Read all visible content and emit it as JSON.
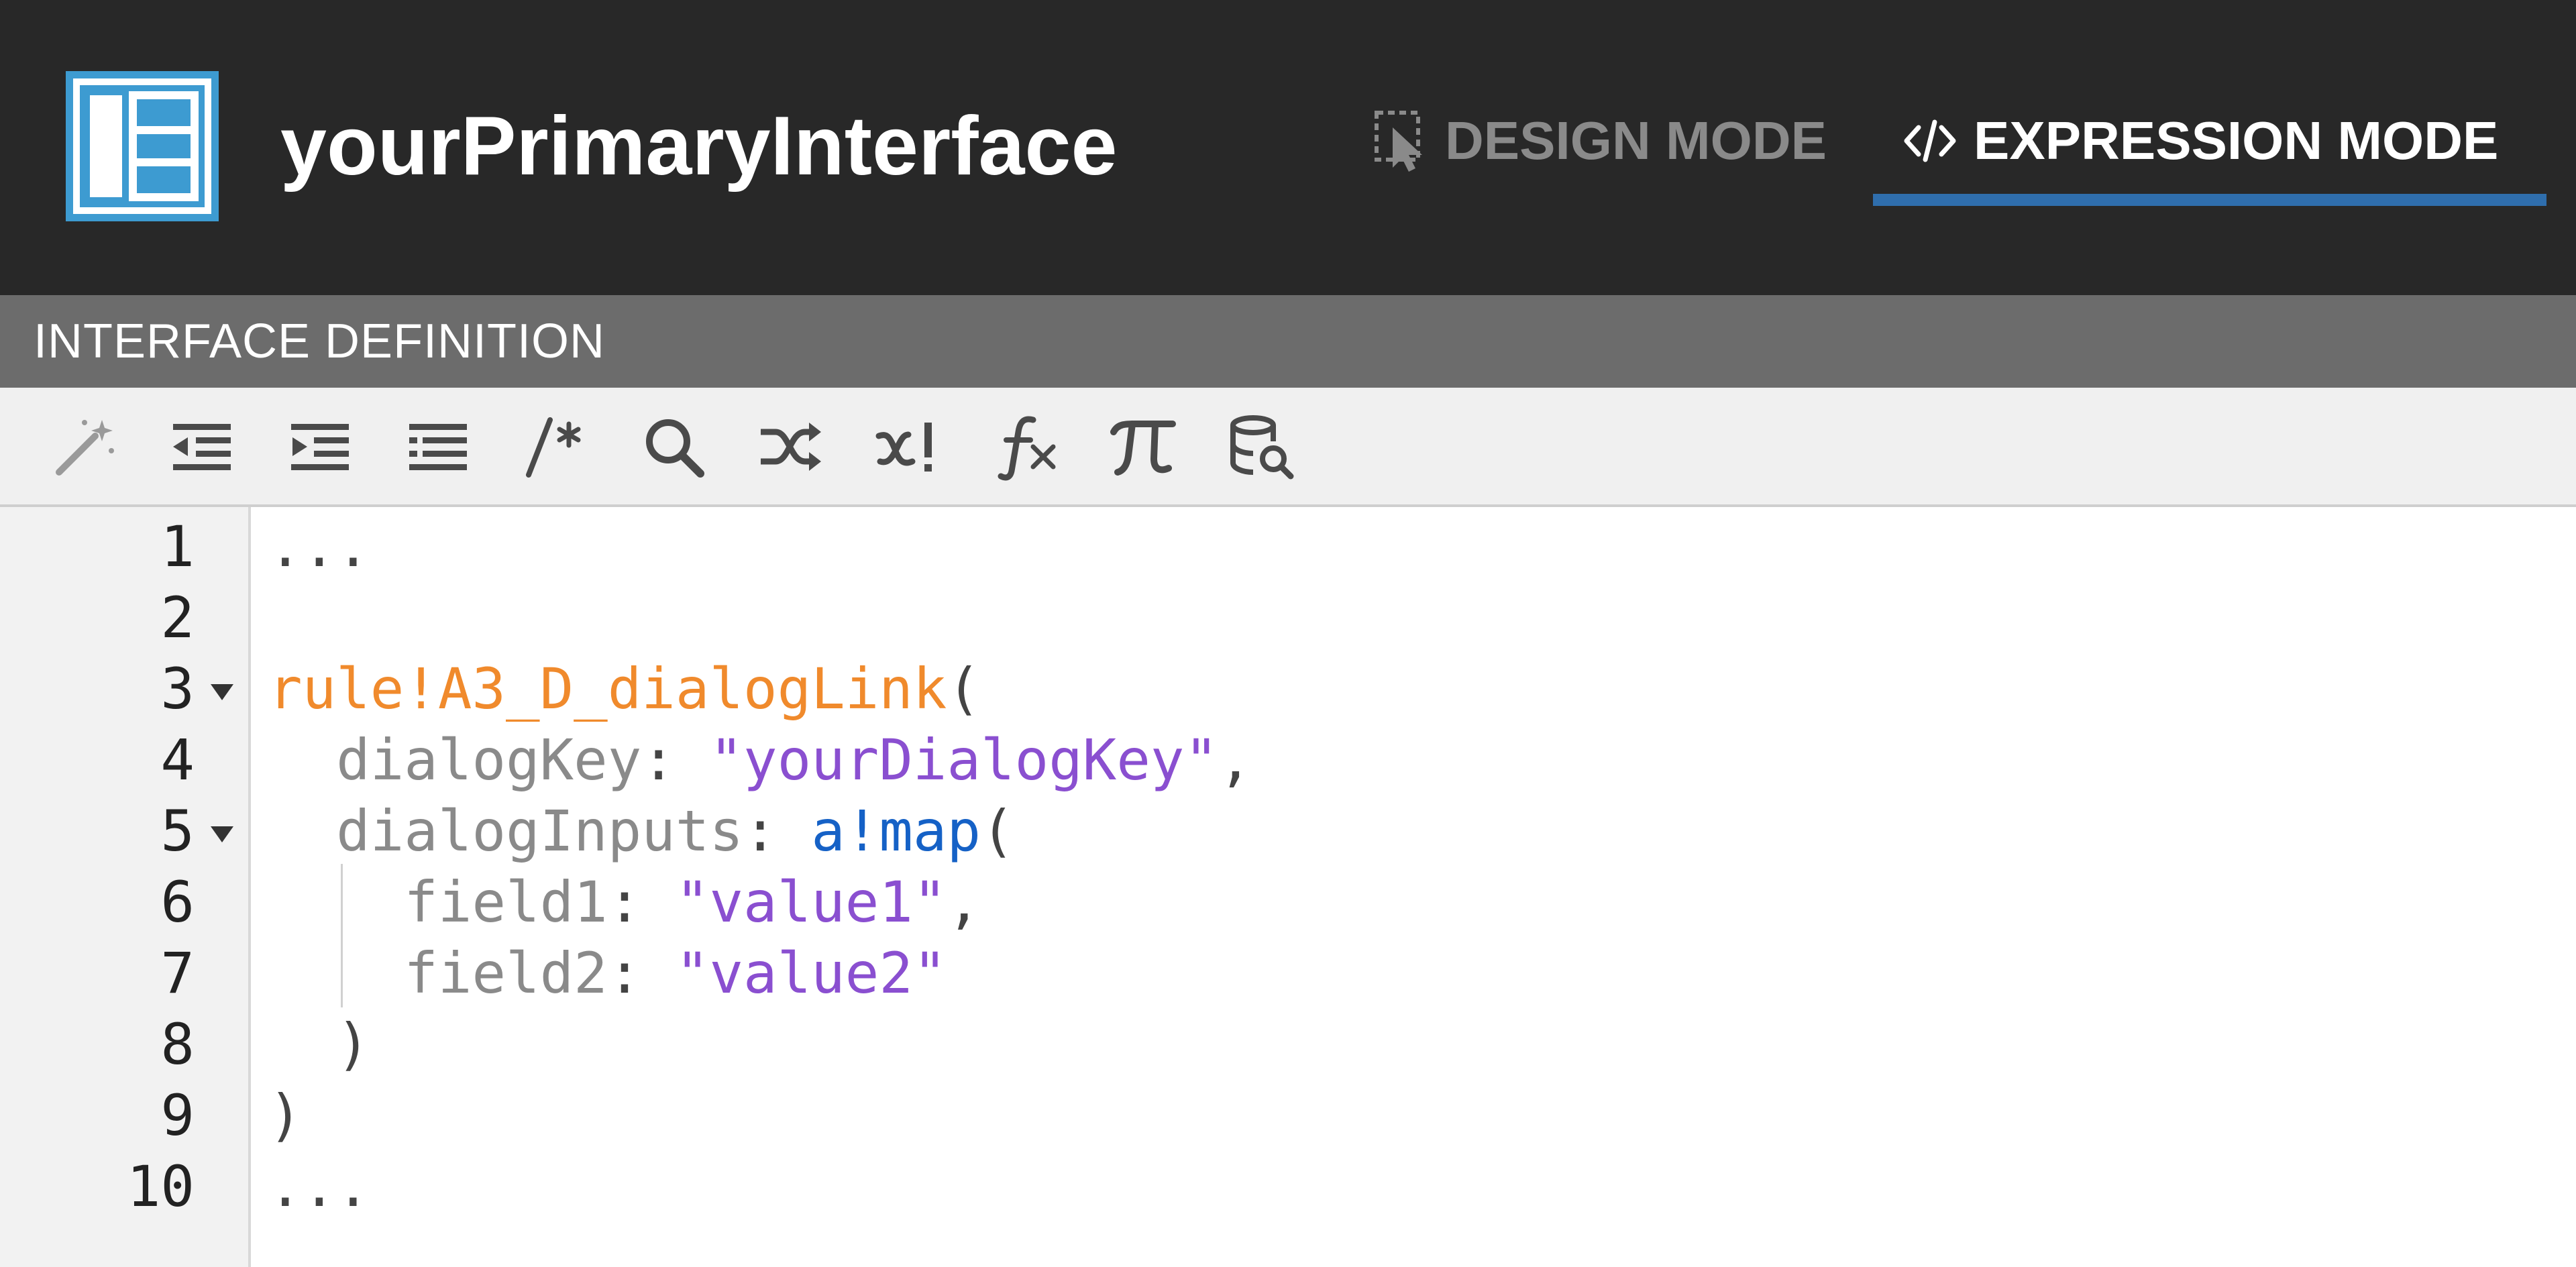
{
  "header": {
    "app_title": "yourPrimaryInterface",
    "icons": {
      "logo": "interface-layout-icon"
    },
    "tabs": [
      {
        "label": "DESIGN MODE",
        "icon": "design-select-icon",
        "active": false
      },
      {
        "label": "EXPRESSION MODE",
        "icon": "code-icon",
        "active": true
      }
    ],
    "colors": {
      "background": "#282828",
      "active_underline": "#2f6ead",
      "logo": "#3d9bd1"
    }
  },
  "section": {
    "title": "INTERFACE DEFINITION"
  },
  "toolbar": {
    "tools": [
      {
        "icon": "magic-wand-icon"
      },
      {
        "icon": "outdent-icon"
      },
      {
        "icon": "indent-icon"
      },
      {
        "icon": "format-lines-icon"
      },
      {
        "icon": "comment-icon",
        "glyph": "/*"
      },
      {
        "icon": "search-icon"
      },
      {
        "icon": "shuffle-icon"
      },
      {
        "icon": "variable-icon",
        "glyph": "x!"
      },
      {
        "icon": "function-icon",
        "glyph": "fx"
      },
      {
        "icon": "pi-icon",
        "glyph": "π"
      },
      {
        "icon": "database-search-icon"
      }
    ]
  },
  "editor": {
    "line_numbers": [
      "1",
      "2",
      "3",
      "4",
      "5",
      "6",
      "7",
      "8",
      "9",
      "10"
    ],
    "code": {
      "line1": "...",
      "line3": {
        "fn": "rule!A3_D_dialogLink",
        "open": "("
      },
      "line4": {
        "indent": "  ",
        "key": "dialogKey",
        "sep": ": ",
        "str": "\"yourDialogKey\"",
        "end": ","
      },
      "line5": {
        "indent": "  ",
        "key": "dialogInputs",
        "sep": ": ",
        "fn": "a!map",
        "open": "("
      },
      "line6": {
        "indent": "    ",
        "key": "field1",
        "sep": ": ",
        "str": "\"value1\"",
        "end": ","
      },
      "line7": {
        "indent": "    ",
        "key": "field2",
        "sep": ": ",
        "str": "\"value2\""
      },
      "line8": {
        "indent": "  ",
        "close": ")"
      },
      "line9": {
        "close": ")"
      },
      "line10": "..."
    },
    "colors": {
      "function": "#f08a2c",
      "key": "#8a8a8a",
      "string": "#8a4fd0",
      "system_fn": "#1561c6"
    }
  }
}
